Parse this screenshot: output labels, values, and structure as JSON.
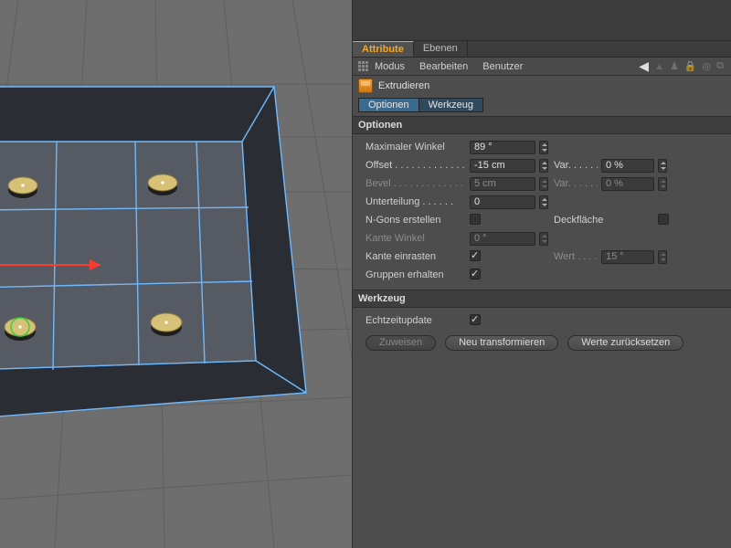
{
  "tabs": {
    "attribute": "Attribute",
    "ebenen": "Ebenen"
  },
  "menubar": {
    "modus": "Modus",
    "bearbeiten": "Bearbeiten",
    "benutzer": "Benutzer"
  },
  "tool": {
    "name": "Extrudieren"
  },
  "subtabs": {
    "optionen": "Optionen",
    "werkzeug": "Werkzeug"
  },
  "section": {
    "optionen": "Optionen",
    "werkzeug": "Werkzeug"
  },
  "labels": {
    "max_winkel": "Maximaler Winkel",
    "offset": "Offset",
    "bevel": "Bevel",
    "unterteilung": "Unterteilung",
    "ngons": "N-Gons erstellen",
    "deckflaeche": "Deckfläche",
    "kante_winkel": "Kante Winkel",
    "kante_einrasten": "Kante einrasten",
    "wert": "Wert",
    "gruppen": "Gruppen erhalten",
    "echtzeit": "Echtzeitupdate",
    "var": "Var."
  },
  "values": {
    "max_winkel": "89 °",
    "offset": "-15 cm",
    "offset_var": "0 %",
    "bevel": "5 cm",
    "bevel_var": "0 %",
    "unterteilung": "0",
    "kante_winkel": "0 °",
    "wert": "15 °"
  },
  "checks": {
    "ngons": false,
    "deckflaeche": false,
    "kante_einrasten": true,
    "gruppen": true,
    "echtzeit": true
  },
  "buttons": {
    "zuweisen": "Zuweisen",
    "neu": "Neu transformieren",
    "reset": "Werte zurücksetzen"
  }
}
